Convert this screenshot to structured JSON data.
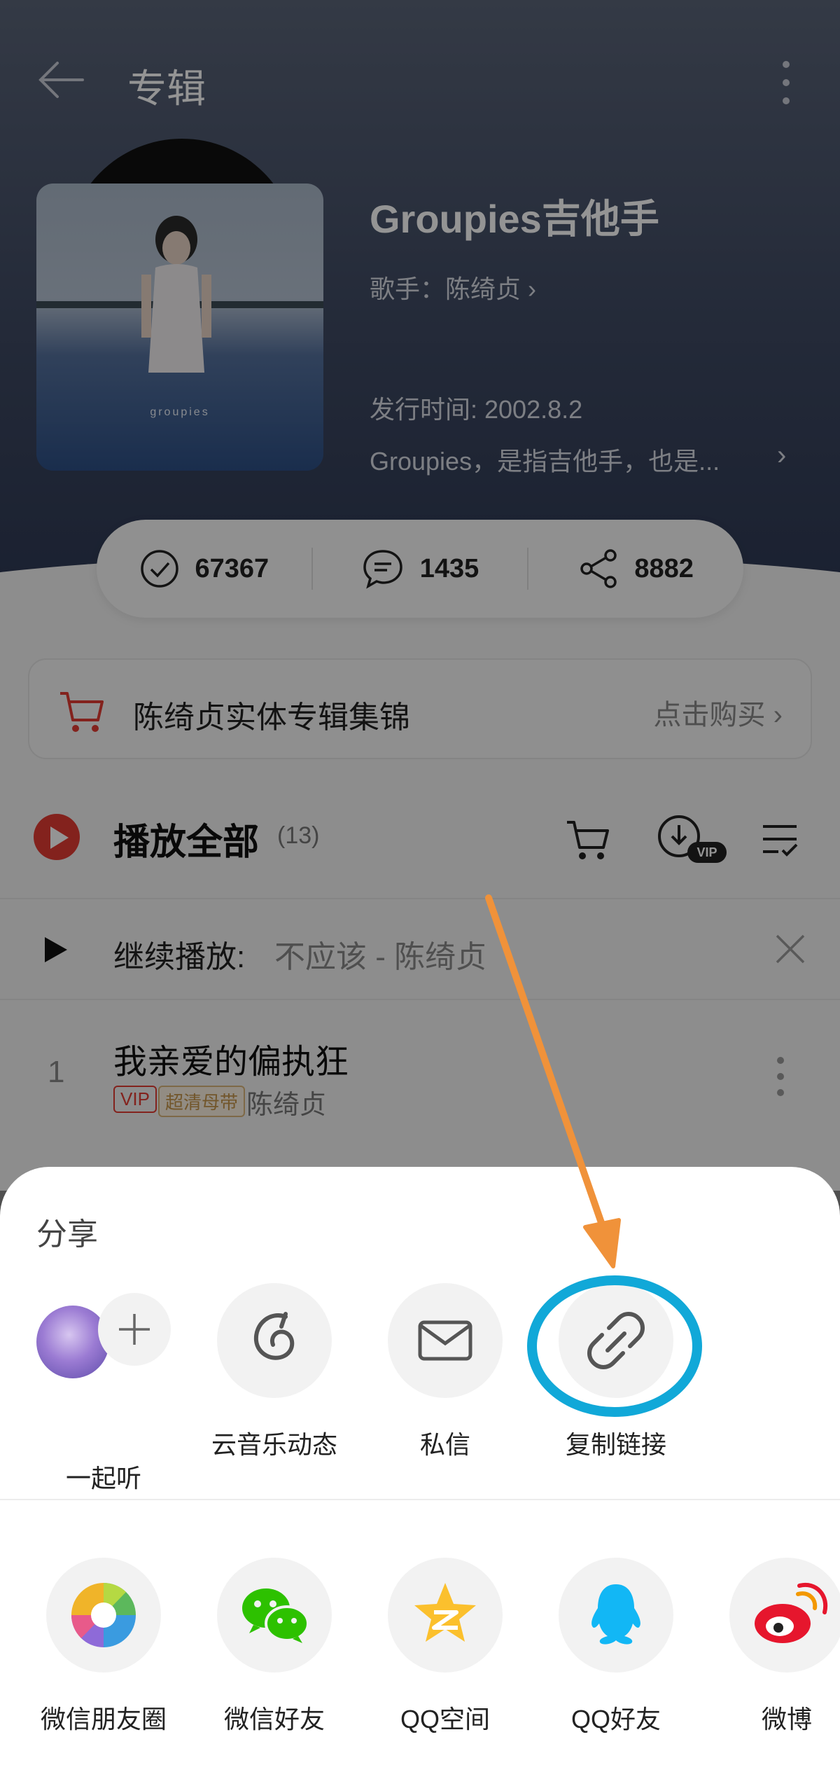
{
  "header": {
    "title": "专辑"
  },
  "album": {
    "name": "Groupies吉他手",
    "artist_line": "歌手：陈绮贞",
    "cover_text": "groupies",
    "release": "发行时间: 2002.8.2",
    "description": "Groupies，是指吉他手，也是..."
  },
  "stats": {
    "collect": "67367",
    "comments": "1435",
    "shares": "8882"
  },
  "shop": {
    "title": "陈绮贞实体专辑集锦",
    "action": "点击购买"
  },
  "play_all": {
    "label": "播放全部",
    "count": "(13)"
  },
  "resume": {
    "label": "继续播放:",
    "song": "不应该 - 陈绮贞"
  },
  "songs": [
    {
      "num": "1",
      "title": "我亲爱的偏执狂",
      "badge_vip": "VIP",
      "badge_quality": "超清母带",
      "artist": "陈绮贞"
    }
  ],
  "share": {
    "title": "分享",
    "row1": [
      {
        "label": "一起听",
        "icon": "listen-together-icon"
      },
      {
        "label": "云音乐动态",
        "icon": "cloud-music-moment-icon"
      },
      {
        "label": "私信",
        "icon": "mail-icon"
      },
      {
        "label": "复制链接",
        "icon": "link-icon"
      }
    ],
    "row2": [
      {
        "label": "微信朋友圈",
        "icon": "wechat-moments-icon"
      },
      {
        "label": "微信好友",
        "icon": "wechat-icon"
      },
      {
        "label": "QQ空间",
        "icon": "qzone-icon"
      },
      {
        "label": "QQ好友",
        "icon": "qq-icon"
      },
      {
        "label": "微博",
        "icon": "weibo-icon"
      }
    ]
  },
  "colors": {
    "accent_red": "#e23b32",
    "annotation_orange": "#f0923a",
    "annotation_cyan": "#11a8d8"
  }
}
